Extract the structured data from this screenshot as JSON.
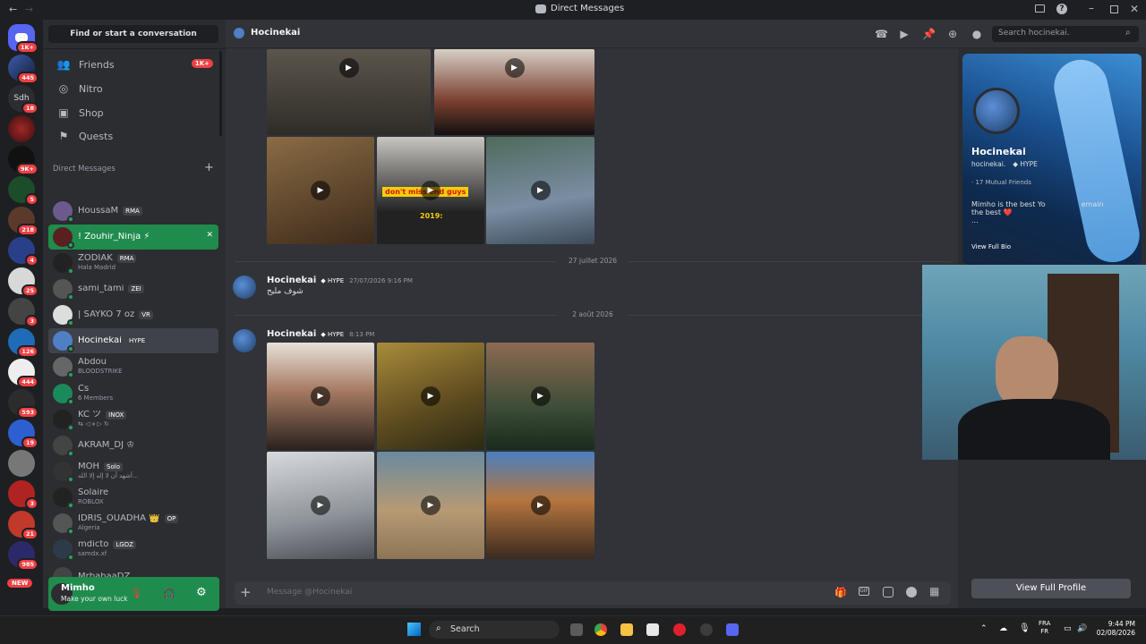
{
  "window": {
    "title": "Direct Messages"
  },
  "servers": [
    {
      "badge": "1K+"
    },
    {
      "badge": "445"
    },
    {
      "label": "Sdh",
      "badge": "18"
    },
    {
      "badge": ""
    },
    {
      "badge": "9K+"
    },
    {
      "badge": "5"
    },
    {
      "badge": "218"
    },
    {
      "badge": "4"
    },
    {
      "badge": "25"
    },
    {
      "badge": "3"
    },
    {
      "badge": "126"
    },
    {
      "badge": "444"
    },
    {
      "badge": "593"
    },
    {
      "badge": "19"
    },
    {
      "badge": ""
    },
    {
      "badge": "3"
    },
    {
      "badge": "21"
    },
    {
      "badge": "985"
    },
    {
      "badge": "NEW"
    }
  ],
  "sidebar": {
    "search_label": "Find or start a conversation",
    "nav": [
      {
        "label": "Friends",
        "badge": "1K+"
      },
      {
        "label": "Nitro"
      },
      {
        "label": "Shop"
      },
      {
        "label": "Quests"
      }
    ],
    "dm_header": "Direct Messages",
    "dms": [
      {
        "name": "HoussaM",
        "tag": "RMA",
        "sub": ""
      },
      {
        "name": "! Zouhir_Ninja ⚡",
        "tag": "",
        "sub": ""
      },
      {
        "name": "ZODIAK",
        "tag": "RMA",
        "sub": "Hala Madrid"
      },
      {
        "name": "sami_tami",
        "tag": "ZEI",
        "sub": ""
      },
      {
        "name": "| SAYKO 7 oz",
        "tag": "VR",
        "sub": ""
      },
      {
        "name": "Hocinekai",
        "tag": "HYPE",
        "sub": ""
      },
      {
        "name": "Abdou",
        "tag": "",
        "sub": "BLOODSTRIKE"
      },
      {
        "name": "Cs",
        "tag": "",
        "sub": "6 Members"
      },
      {
        "name": "KC ツ",
        "tag": "INOX",
        "sub": "⇆ ◁ ⏸ ▷ ↻"
      },
      {
        "name": "AKRAM_DJ ♔",
        "tag": "",
        "sub": ""
      },
      {
        "name": "MOH",
        "tag": "Solo",
        "sub": "أشهد أن لا إله إلا الله..."
      },
      {
        "name": "Solaire",
        "tag": "",
        "sub": "ROBLOX"
      },
      {
        "name": "IDRIS_OUADHA 👑",
        "tag": "OP",
        "sub": "Algeria"
      },
      {
        "name": "mdicto",
        "tag": "LGDZ",
        "sub": "samdx.xf"
      },
      {
        "name": "MrbahaaDZ",
        "tag": "",
        "sub": ""
      }
    ],
    "user": {
      "name": "Mimho",
      "status": "Make your own luck"
    }
  },
  "header": {
    "channel_name": "Hocinekai",
    "search_placeholder": "Search hocinekai."
  },
  "messages": {
    "date1": "27 juillet 2026",
    "date2": "2 août 2026",
    "msg1": {
      "author": "Hocinekai",
      "badge": "HYPE",
      "time": "27/07/2026 9:16 PM",
      "text": "شوف مليح"
    },
    "msg2": {
      "author": "Hocinekai",
      "badge": "HYPE",
      "time": "8:13 PM"
    },
    "overlay_text": "don't miss end guys",
    "overlay_year": "2019:"
  },
  "composer": {
    "placeholder": "Message @Hocinekai"
  },
  "profile": {
    "display_name": "Hocinekai",
    "username": "hocinekai.",
    "badge": "HYPE",
    "mutual": "· 17 Mutual Friends",
    "bio_line1": "Mimho is the best Yo",
    "bio_line1b": "emain",
    "bio_line2": "the best ❤️",
    "bio_more": "...",
    "view_bio": "View Full Bio",
    "view_profile": "View Full Profile"
  },
  "taskbar": {
    "search": "Search",
    "lang1": "FRA",
    "lang2": "FR",
    "time": "9:44 PM",
    "date": "02/08/2026"
  },
  "colors": {
    "accent": "#5865f2",
    "online": "#23a55a",
    "badge_red": "#f23f43",
    "userbar": "#1f8b4c"
  }
}
